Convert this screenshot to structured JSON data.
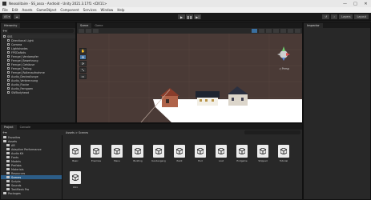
{
  "window": {
    "title": "Neosolitaire - SS_assa - Android - Unity 2021.3.17f1 <DX11>",
    "controls": [
      "—",
      "□",
      "✕"
    ]
  },
  "menu": [
    "File",
    "Edit",
    "Assets",
    "GameObject",
    "Component",
    "Services",
    "Window",
    "Help"
  ],
  "toolbar": {
    "account_label": "AS ▾",
    "cloud_icon": "cloud-icon",
    "play": "▶",
    "pause": "❚❚",
    "step": "▶|",
    "layers_label": "Layers",
    "layout_label": "Layout"
  },
  "hierarchy": {
    "tab": "Hierarchy",
    "items": [
      {
        "label": "SSS",
        "indent": 0,
        "scene": true
      },
      {
        "label": "Directional Light",
        "indent": 1
      },
      {
        "label": "Camera",
        "indent": 1
      },
      {
        "label": "Lightshades",
        "indent": 1
      },
      {
        "label": "FPSDoNdis",
        "indent": 1
      },
      {
        "label": "Ferngel_Verdampfer",
        "indent": 1
      },
      {
        "label": "Ferngel_Bewehrung",
        "indent": 1
      },
      {
        "label": "Ferngel_Gehäuse",
        "indent": 1
      },
      {
        "label": "Ferngel_Treiing",
        "indent": 1
      },
      {
        "label": "Ferngel_Rollenaufnahme",
        "indent": 1
      },
      {
        "label": "Audio_Deckrollunge",
        "indent": 1
      },
      {
        "label": "Audio_Verbrennung",
        "indent": 1
      },
      {
        "label": "Audio_Flocke",
        "indent": 1
      },
      {
        "label": "Audio_Ferngaen",
        "indent": 1
      },
      {
        "label": "SWBsdyhead",
        "indent": 1
      }
    ]
  },
  "scene": {
    "tabs": [
      "Scene",
      "Game"
    ],
    "persp_label": "◁ Persp"
  },
  "inspector": {
    "tab": "Inspector"
  },
  "project": {
    "tabs": [
      "Project",
      "Console"
    ],
    "breadcrumb": "Assets > Scenes",
    "tree": [
      {
        "label": "Favorites",
        "indent": 0
      },
      {
        "label": "Assets",
        "indent": 0
      },
      {
        "label": "AR",
        "indent": 1
      },
      {
        "label": "Adaptive Performance",
        "indent": 1
      },
      {
        "label": "Audio Kit",
        "indent": 1
      },
      {
        "label": "Fonts",
        "indent": 1
      },
      {
        "label": "Models",
        "indent": 1
      },
      {
        "label": "Prefabs",
        "indent": 1
      },
      {
        "label": "Materials",
        "indent": 1
      },
      {
        "label": "Resources",
        "indent": 1
      },
      {
        "label": "Scenes",
        "indent": 1,
        "selected": true
      },
      {
        "label": "Scripts",
        "indent": 1
      },
      {
        "label": "Sounds",
        "indent": 1
      },
      {
        "label": "TextMesh Pro",
        "indent": 1
      },
      {
        "label": "Packages",
        "indent": 0
      }
    ],
    "assets": [
      "Basic",
      "Enemies",
      "Menu",
      "Building",
      "Kundengang",
      "Paint",
      "Hud",
      "Lost",
      "Endgame",
      "Shipped",
      "Tutorial",
      "Intro"
    ]
  },
  "colors": {
    "panel_bg": "#282828",
    "dark_bg": "#191919",
    "selection": "#2c5d87",
    "ground_white": "#ffffff",
    "scene_brown": "#4c3a36"
  }
}
